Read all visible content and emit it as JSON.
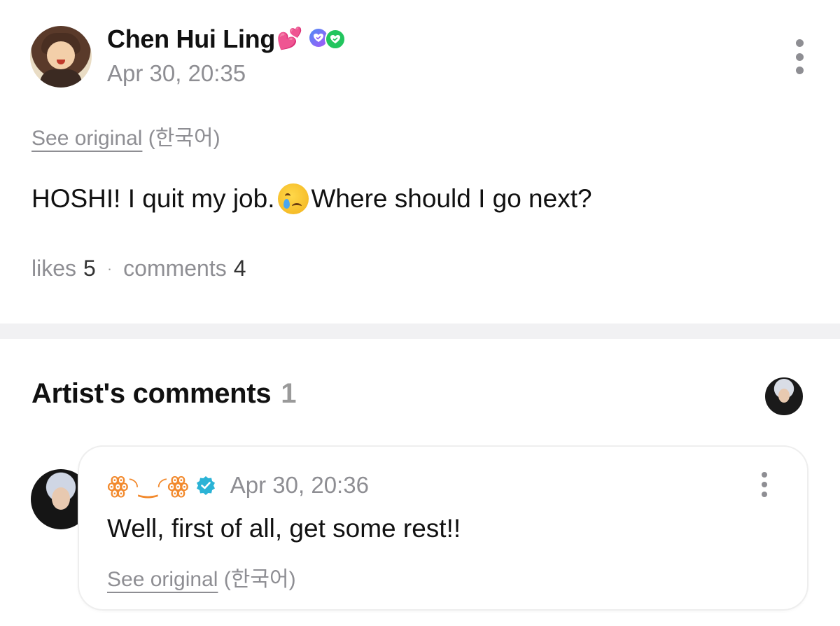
{
  "post": {
    "author_name": "Chen Hui Ling",
    "author_emoji": "💕",
    "timestamp": "Apr 30, 20:35",
    "see_original": "See original",
    "original_language": "(한국어)",
    "body_before_emoji": "HOSHI! I quit my job.",
    "body_emoji_icon": "crying-face",
    "body_after_emoji": "Where should I go next?",
    "likes_label": "likes",
    "likes_count": "5",
    "separator": "·",
    "comments_label": "comments",
    "comments_count": "4",
    "badges": [
      {
        "icon": "heart-check-icon",
        "color": "#8b5cf6"
      },
      {
        "icon": "heart-check-icon",
        "color": "#22c55e"
      }
    ]
  },
  "artist_section": {
    "title": "Artist's comments",
    "count": "1"
  },
  "comment": {
    "artist_name": "ᵔ◡ᵔ",
    "artist_name_display": "ꙮ◝‿◜ꙮ",
    "verified_icon": "verified-check-icon",
    "verified_color": "#2bb3d6",
    "timestamp": "Apr 30, 20:36",
    "body": "Well, first of all, get some rest!!",
    "see_original": "See original",
    "original_language": "(한국어)"
  },
  "colors": {
    "muted_text": "#8e8e93",
    "artist_name": "#f28a2e",
    "divider": "#f1f1f3"
  }
}
